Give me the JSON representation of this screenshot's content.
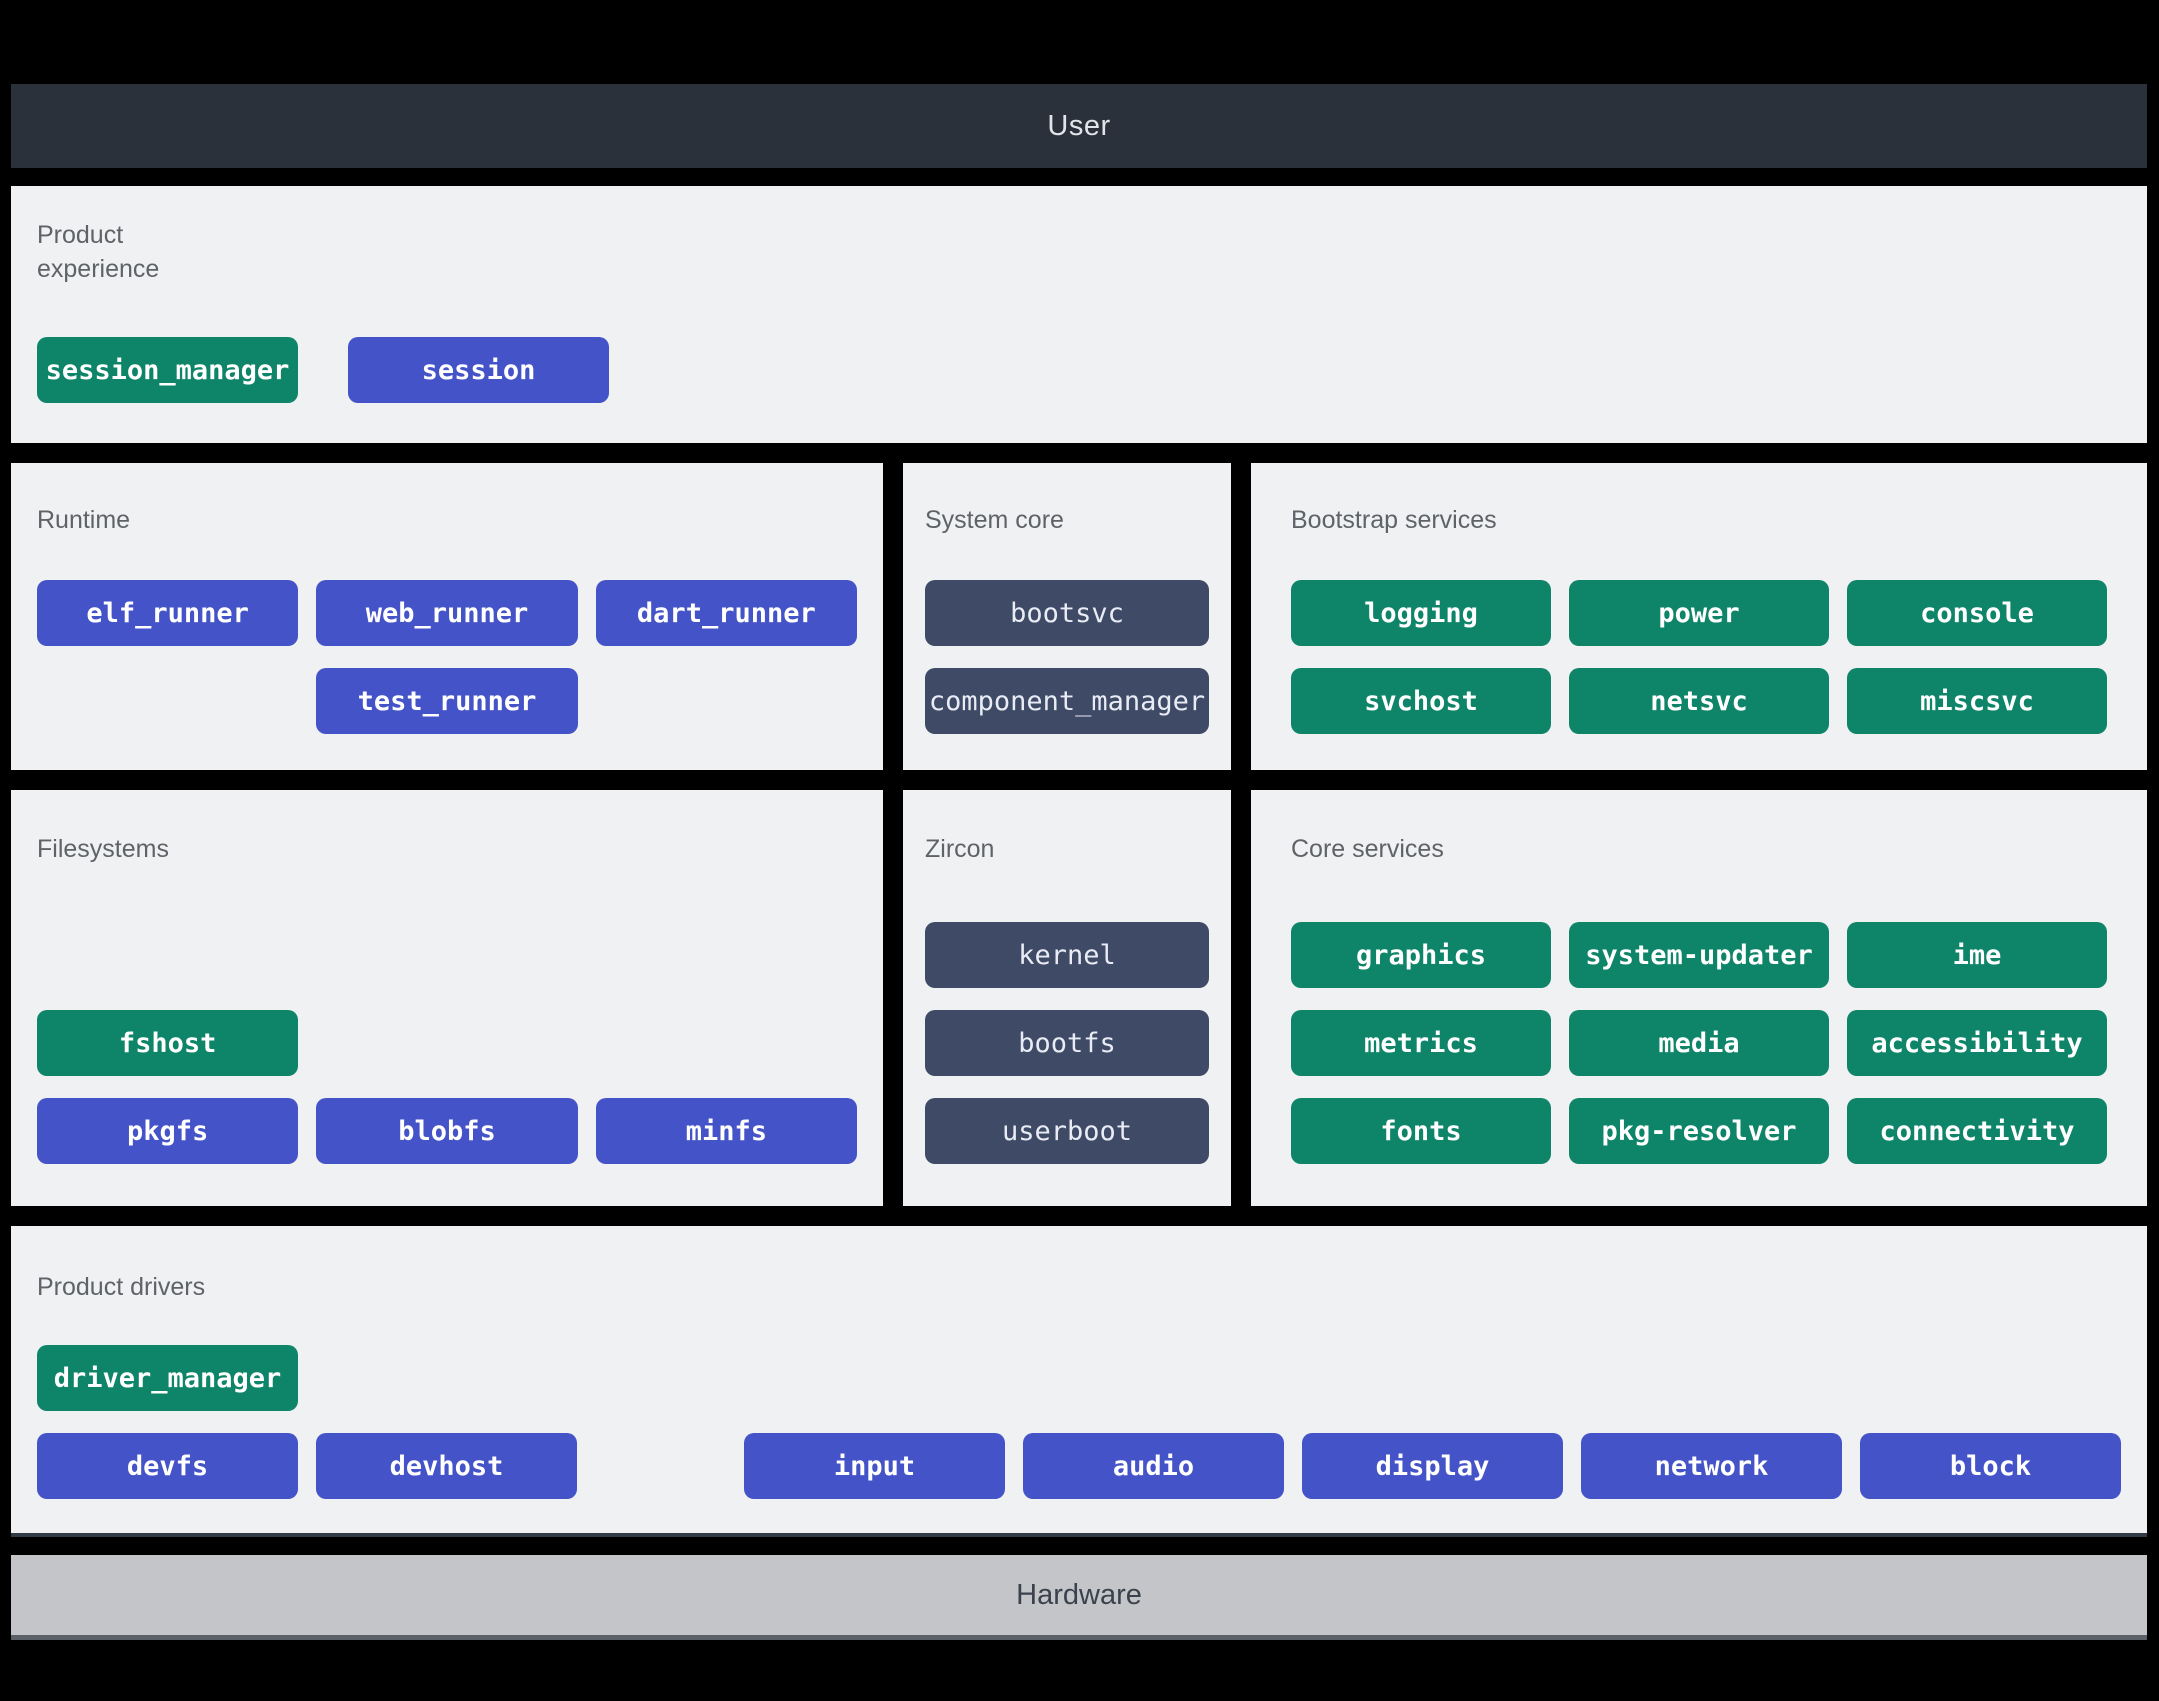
{
  "colors": {
    "green": "#0e8468",
    "blue": "#4453c8",
    "slate": "#3e4a66",
    "panel-bg": "#f0f1f3",
    "title-gray": "#5f6368",
    "topbar-bg": "#2a313b",
    "topbar-text": "#e1e4e8",
    "hardware-bg": "#c3c5c9",
    "hardware-text": "#3b424d"
  },
  "top_bar": {
    "label": "User"
  },
  "bottom_bar": {
    "label": "Hardware"
  },
  "sections": {
    "product_experience": {
      "title": "Product experience",
      "chips": [
        {
          "label": "session_manager",
          "color": "green"
        },
        {
          "label": "session",
          "color": "blue"
        }
      ]
    },
    "runtime": {
      "title": "Runtime",
      "chips": [
        {
          "label": "elf_runner",
          "color": "blue"
        },
        {
          "label": "web_runner",
          "color": "blue"
        },
        {
          "label": "dart_runner",
          "color": "blue"
        },
        {
          "label": "test_runner",
          "color": "blue",
          "col": 2
        }
      ]
    },
    "system_core": {
      "title": "System core",
      "chips": [
        {
          "label": "bootsvc",
          "color": "slate"
        },
        {
          "label": "component_manager",
          "color": "slate"
        }
      ]
    },
    "bootstrap_services": {
      "title": "Bootstrap services",
      "chips": [
        {
          "label": "logging",
          "color": "green"
        },
        {
          "label": "power",
          "color": "green"
        },
        {
          "label": "console",
          "color": "green"
        },
        {
          "label": "svchost",
          "color": "green"
        },
        {
          "label": "netsvc",
          "color": "green"
        },
        {
          "label": "miscsvc",
          "color": "green"
        }
      ]
    },
    "filesystems": {
      "title": "Filesystems",
      "row1": [
        {
          "label": "fshost",
          "color": "green"
        }
      ],
      "row2": [
        {
          "label": "pkgfs",
          "color": "blue"
        },
        {
          "label": "blobfs",
          "color": "blue"
        },
        {
          "label": "minfs",
          "color": "blue"
        }
      ]
    },
    "zircon": {
      "title": "Zircon",
      "chips": [
        {
          "label": "kernel",
          "color": "slate"
        },
        {
          "label": "bootfs",
          "color": "slate"
        },
        {
          "label": "userboot",
          "color": "slate"
        }
      ]
    },
    "core_services": {
      "title": "Core services",
      "chips": [
        {
          "label": "graphics",
          "color": "green"
        },
        {
          "label": "system-updater",
          "color": "green"
        },
        {
          "label": "ime",
          "color": "green"
        },
        {
          "label": "metrics",
          "color": "green"
        },
        {
          "label": "media",
          "color": "green"
        },
        {
          "label": "accessibility",
          "color": "green"
        },
        {
          "label": "fonts",
          "color": "green"
        },
        {
          "label": "pkg-resolver",
          "color": "green"
        },
        {
          "label": "connectivity",
          "color": "green"
        }
      ]
    },
    "product_drivers": {
      "title": "Product drivers",
      "row1": [
        {
          "label": "driver_manager",
          "color": "green"
        }
      ],
      "row2_left": [
        {
          "label": "devfs",
          "color": "blue"
        },
        {
          "label": "devhost",
          "color": "blue"
        }
      ],
      "row2_right": [
        {
          "label": "input",
          "color": "blue"
        },
        {
          "label": "audio",
          "color": "blue"
        },
        {
          "label": "display",
          "color": "blue"
        },
        {
          "label": "network",
          "color": "blue"
        },
        {
          "label": "block",
          "color": "blue"
        }
      ]
    }
  }
}
